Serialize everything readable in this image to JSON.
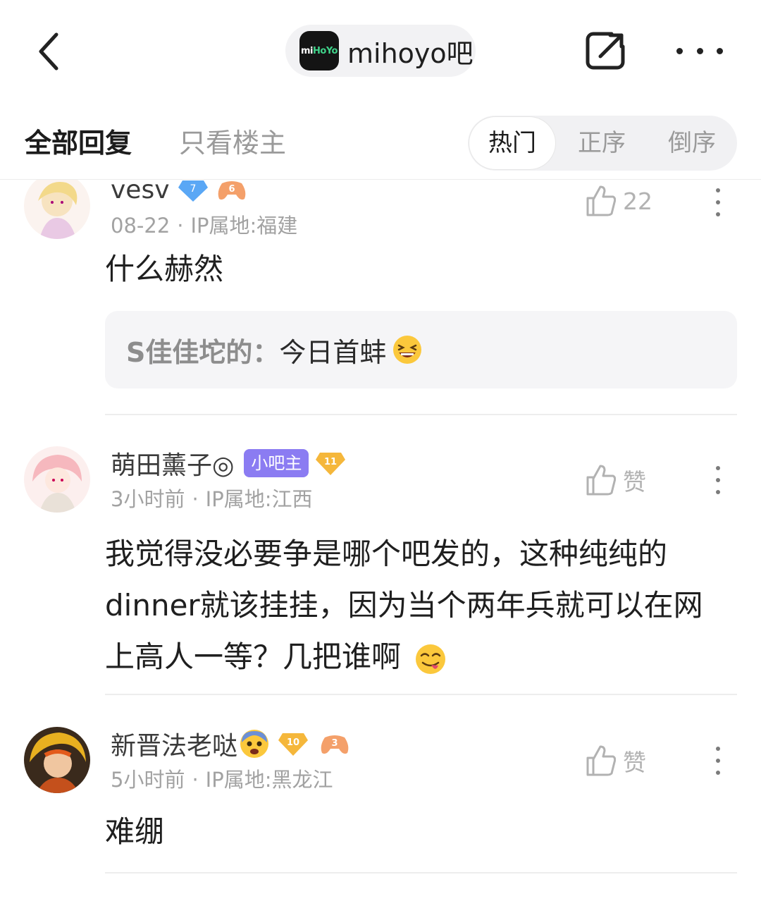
{
  "header": {
    "back_icon": "chevron-left-icon",
    "forum_logo_text": "miHoYo",
    "forum_name": "mihoyo吧",
    "share_icon": "share-icon",
    "more_icon": "more-horizontal-icon"
  },
  "tabs": {
    "all_replies": "全部回复",
    "owner_only": "只看楼主",
    "sort": [
      "热门",
      "正序",
      "倒序"
    ],
    "sort_active": "热门"
  },
  "comments": [
    {
      "user": "vesv",
      "level": "7",
      "game_badge": "6",
      "time": "08-22",
      "ip": "IP属地:福建",
      "likes": "22",
      "text": "什么赫然",
      "quote": {
        "user": "S佳佳坨的：",
        "text": "今日首蚌",
        "emoji": "grinning-squint-emoji"
      }
    },
    {
      "user": "萌田薰子◎",
      "role": "小吧主",
      "level": "11",
      "time": "3小时前",
      "ip": "IP属地:江西",
      "likes": "赞",
      "text": "我觉得没必要争是哪个吧发的，这种纯纯的dinner就该挂挂，因为当个两年兵就可以在网上高人一等？几把谁啊",
      "text_emoji": "yum-emoji"
    },
    {
      "user": "新晋法老哒",
      "name_emoji": "anxious-sweat-emoji",
      "level": "10",
      "game_badge": "3",
      "time": "5小时前",
      "ip": "IP属地:黑龙江",
      "likes": "赞",
      "text": "难绷"
    }
  ],
  "colors": {
    "accent_purple": "#8b7cf2",
    "gold_badge": "#f5b73b",
    "blue_badge": "#5aa7f5",
    "game_badge": "#f4a06a"
  }
}
